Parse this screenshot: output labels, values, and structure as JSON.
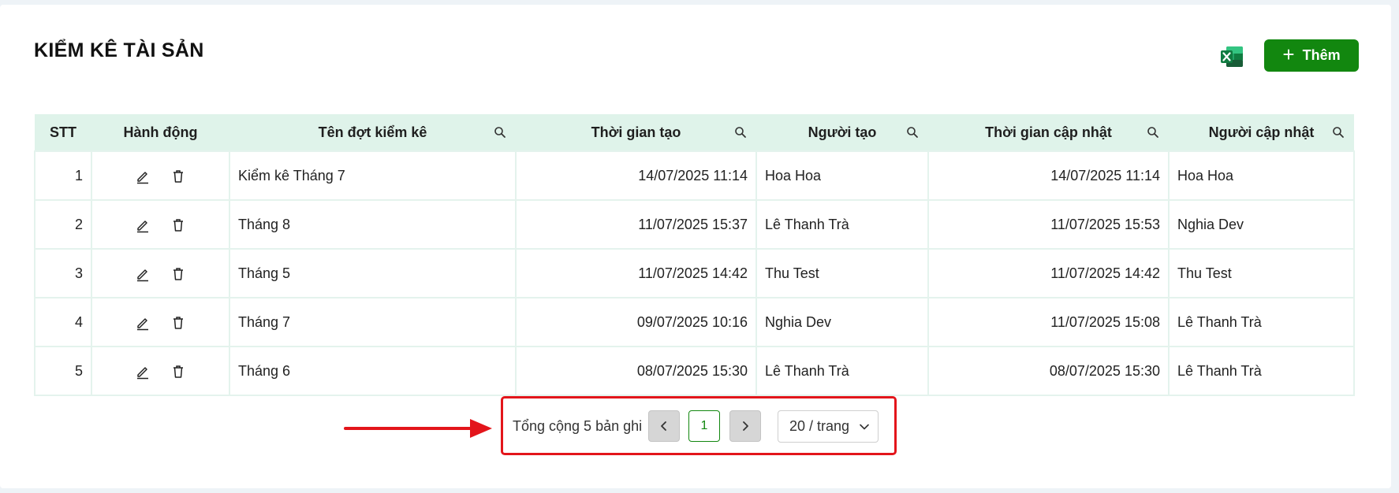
{
  "page": {
    "title": "KIỂM KÊ TÀI SẢN",
    "add_label": "Thêm",
    "excel_icon": "excel-icon"
  },
  "table": {
    "columns": [
      "STT",
      "Hành động",
      "Tên đợt kiểm kê",
      "Thời gian tạo",
      "Người tạo",
      "Thời gian cập nhật",
      "Người cập nhật"
    ],
    "rows": [
      {
        "stt": "1",
        "name": "Kiểm kê Tháng 7",
        "created_at": "14/07/2025 11:14",
        "created_by": "Hoa Hoa",
        "updated_at": "14/07/2025 11:14",
        "updated_by": "Hoa Hoa"
      },
      {
        "stt": "2",
        "name": "Tháng 8",
        "created_at": "11/07/2025 15:37",
        "created_by": "Lê Thanh Trà",
        "updated_at": "11/07/2025 15:53",
        "updated_by": "Nghia Dev"
      },
      {
        "stt": "3",
        "name": "Tháng 5",
        "created_at": "11/07/2025 14:42",
        "created_by": "Thu Test",
        "updated_at": "11/07/2025 14:42",
        "updated_by": "Thu Test"
      },
      {
        "stt": "4",
        "name": "Tháng 7",
        "created_at": "09/07/2025 10:16",
        "created_by": "Nghia Dev",
        "updated_at": "11/07/2025 15:08",
        "updated_by": "Lê Thanh Trà"
      },
      {
        "stt": "5",
        "name": "Tháng 6",
        "created_at": "08/07/2025 15:30",
        "created_by": "Lê Thanh Trà",
        "updated_at": "08/07/2025 15:30",
        "updated_by": "Lê Thanh Trà"
      }
    ]
  },
  "pagination": {
    "total_text": "Tổng cộng 5 bản ghi",
    "current_page": "1",
    "page_size": "20 / trang"
  },
  "colors": {
    "accent": "#12870f",
    "header_bg": "#dff3ea",
    "annotation": "#e3151b"
  }
}
